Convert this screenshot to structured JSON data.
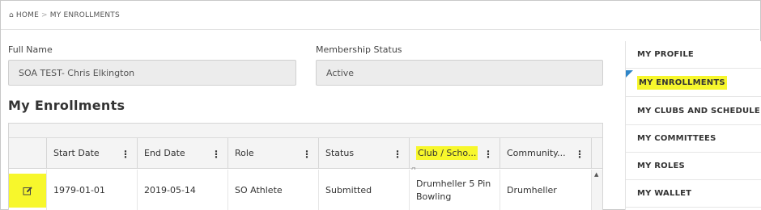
{
  "breadcrumb": {
    "home_icon": "home-icon",
    "home": "HOME",
    "separator": ">",
    "current": "MY ENROLLMENTS"
  },
  "profile": {
    "full_name_label": "Full Name",
    "full_name_value": "SOA TEST- Chris Elkington",
    "membership_label": "Membership Status",
    "membership_value": "Active"
  },
  "section_title": "My Enrollments",
  "grid": {
    "columns": [
      "Start Date",
      "End Date",
      "Role",
      "Status",
      "Club / Scho...",
      "Community..."
    ],
    "column_menu_icon": "⋮",
    "partial_row_peek": "g",
    "rows": [
      {
        "edit_icon": "edit-icon",
        "start_date": "1979-01-01",
        "end_date": "2019-05-14",
        "role": "SO Athlete",
        "status": "Submitted",
        "club": "Drumheller 5 Pin Bowling",
        "community": "Drumheller"
      }
    ]
  },
  "sidebar": {
    "items": [
      {
        "label": "MY PROFILE",
        "active": false
      },
      {
        "label": "MY ENROLLMENTS",
        "active": true
      },
      {
        "label": "MY CLUBS AND SCHEDULE",
        "active": false
      },
      {
        "label": "MY COMMITTEES",
        "active": false
      },
      {
        "label": "MY ROLES",
        "active": false
      },
      {
        "label": "MY WALLET",
        "active": false
      }
    ]
  },
  "colors": {
    "highlight": "#f7f72c",
    "active_marker": "#2f86c8"
  }
}
